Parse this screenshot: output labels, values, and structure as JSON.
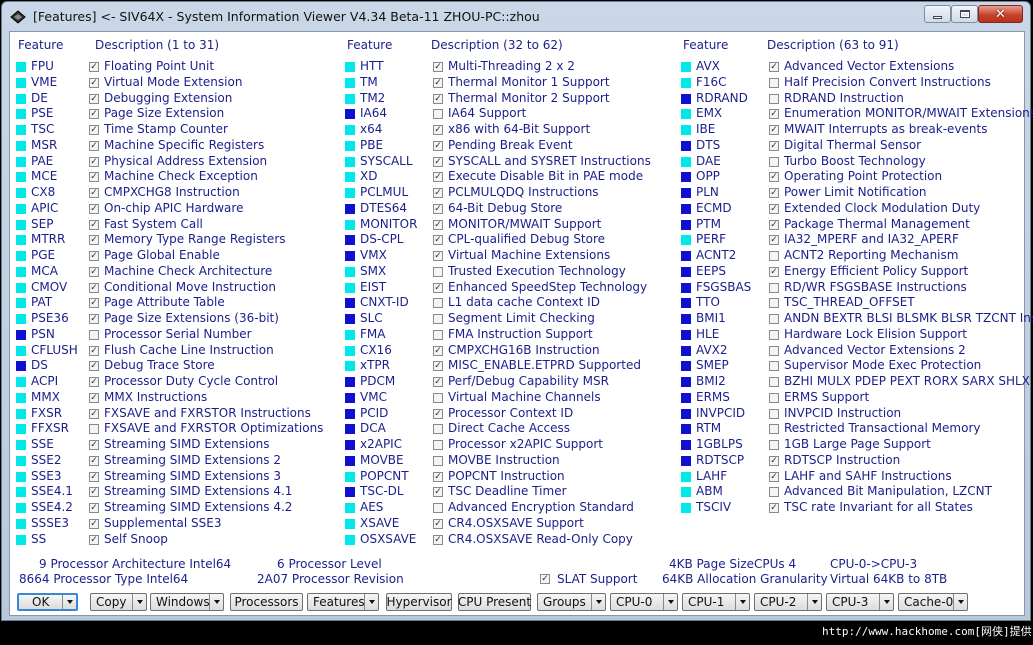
{
  "window": {
    "title": "[Features] <- SIV64X - System Information Viewer V4.34 Beta-11 ZHOU-PC::zhou",
    "icon": "app-icon"
  },
  "colors": {
    "cyan": "#00e8e8",
    "blue": "#1010d0",
    "text": "#1a1f8a"
  },
  "columns": [
    {
      "feature_header": "Feature",
      "desc_header": "Description (1 to 31)",
      "rows": [
        {
          "abbr": "FPU",
          "desc": "Floating Point Unit",
          "checked": true,
          "color": "cyan"
        },
        {
          "abbr": "VME",
          "desc": "Virtual Mode Extension",
          "checked": true,
          "color": "cyan"
        },
        {
          "abbr": "DE",
          "desc": "Debugging Extension",
          "checked": true,
          "color": "cyan"
        },
        {
          "abbr": "PSE",
          "desc": "Page Size Extension",
          "checked": true,
          "color": "cyan"
        },
        {
          "abbr": "TSC",
          "desc": "Time Stamp Counter",
          "checked": true,
          "color": "cyan"
        },
        {
          "abbr": "MSR",
          "desc": "Machine Specific Registers",
          "checked": true,
          "color": "cyan"
        },
        {
          "abbr": "PAE",
          "desc": "Physical Address Extension",
          "checked": true,
          "color": "cyan"
        },
        {
          "abbr": "MCE",
          "desc": "Machine Check Exception",
          "checked": true,
          "color": "cyan"
        },
        {
          "abbr": "CX8",
          "desc": "CMPXCHG8 Instruction",
          "checked": true,
          "color": "cyan"
        },
        {
          "abbr": "APIC",
          "desc": "On-chip APIC Hardware",
          "checked": true,
          "color": "cyan"
        },
        {
          "abbr": "SEP",
          "desc": "Fast System Call",
          "checked": true,
          "color": "cyan"
        },
        {
          "abbr": "MTRR",
          "desc": "Memory Type Range Registers",
          "checked": true,
          "color": "cyan"
        },
        {
          "abbr": "PGE",
          "desc": "Page Global Enable",
          "checked": true,
          "color": "cyan"
        },
        {
          "abbr": "MCA",
          "desc": "Machine Check Architecture",
          "checked": true,
          "color": "cyan"
        },
        {
          "abbr": "CMOV",
          "desc": "Conditional Move Instruction",
          "checked": true,
          "color": "cyan"
        },
        {
          "abbr": "PAT",
          "desc": "Page Attribute Table",
          "checked": true,
          "color": "cyan"
        },
        {
          "abbr": "PSE36",
          "desc": "Page Size Extensions (36-bit)",
          "checked": true,
          "color": "cyan"
        },
        {
          "abbr": "PSN",
          "desc": "Processor Serial Number",
          "checked": false,
          "color": "blue"
        },
        {
          "abbr": "CFLUSH",
          "desc": "Flush Cache Line Instruction",
          "checked": true,
          "color": "cyan"
        },
        {
          "abbr": "DS",
          "desc": "Debug Trace Store",
          "checked": true,
          "color": "blue"
        },
        {
          "abbr": "ACPI",
          "desc": "Processor Duty Cycle Control",
          "checked": true,
          "color": "cyan"
        },
        {
          "abbr": "MMX",
          "desc": "MMX Instructions",
          "checked": true,
          "color": "cyan"
        },
        {
          "abbr": "FXSR",
          "desc": "FXSAVE and FXRSTOR Instructions",
          "checked": true,
          "color": "cyan"
        },
        {
          "abbr": "FFXSR",
          "desc": "FXSAVE and FXRSTOR Optimizations",
          "checked": false,
          "color": "cyan"
        },
        {
          "abbr": "SSE",
          "desc": "Streaming SIMD Extensions",
          "checked": true,
          "color": "cyan"
        },
        {
          "abbr": "SSE2",
          "desc": "Streaming SIMD Extensions 2",
          "checked": true,
          "color": "cyan"
        },
        {
          "abbr": "SSE3",
          "desc": "Streaming SIMD Extensions 3",
          "checked": true,
          "color": "cyan"
        },
        {
          "abbr": "SSE4.1",
          "desc": "Streaming SIMD Extensions 4.1",
          "checked": true,
          "color": "cyan"
        },
        {
          "abbr": "SSE4.2",
          "desc": "Streaming SIMD Extensions 4.2",
          "checked": true,
          "color": "cyan"
        },
        {
          "abbr": "SSSE3",
          "desc": "Supplemental SSE3",
          "checked": true,
          "color": "cyan"
        },
        {
          "abbr": "SS",
          "desc": "Self Snoop",
          "checked": true,
          "color": "cyan"
        }
      ]
    },
    {
      "feature_header": "Feature",
      "desc_header": "Description (32 to 62)",
      "rows": [
        {
          "abbr": "HTT",
          "desc": "Multi-Threading 2 x 2",
          "checked": true,
          "color": "cyan"
        },
        {
          "abbr": "TM",
          "desc": "Thermal Monitor 1 Support",
          "checked": true,
          "color": "cyan"
        },
        {
          "abbr": "TM2",
          "desc": "Thermal Monitor 2 Support",
          "checked": true,
          "color": "cyan"
        },
        {
          "abbr": "IA64",
          "desc": "IA64 Support",
          "checked": false,
          "color": "blue"
        },
        {
          "abbr": "x64",
          "desc": "x86 with 64-Bit Support",
          "checked": true,
          "color": "cyan"
        },
        {
          "abbr": "PBE",
          "desc": "Pending Break Event",
          "checked": true,
          "color": "cyan"
        },
        {
          "abbr": "SYSCALL",
          "desc": "SYSCALL and SYSRET Instructions",
          "checked": true,
          "color": "cyan"
        },
        {
          "abbr": "XD",
          "desc": "Execute Disable Bit in PAE mode",
          "checked": true,
          "color": "cyan"
        },
        {
          "abbr": "PCLMUL",
          "desc": "PCLMULQDQ Instructions",
          "checked": true,
          "color": "cyan"
        },
        {
          "abbr": "DTES64",
          "desc": "64-Bit Debug Store",
          "checked": true,
          "color": "blue"
        },
        {
          "abbr": "MONITOR",
          "desc": "MONITOR/MWAIT Support",
          "checked": true,
          "color": "cyan"
        },
        {
          "abbr": "DS-CPL",
          "desc": "CPL-qualified Debug Store",
          "checked": true,
          "color": "blue"
        },
        {
          "abbr": "VMX",
          "desc": "Virtual Machine Extensions",
          "checked": true,
          "color": "blue"
        },
        {
          "abbr": "SMX",
          "desc": "Trusted Execution Technology",
          "checked": false,
          "color": "cyan"
        },
        {
          "abbr": "EIST",
          "desc": "Enhanced SpeedStep Technology",
          "checked": true,
          "color": "cyan"
        },
        {
          "abbr": "CNXT-ID",
          "desc": "L1 data cache Context ID",
          "checked": false,
          "color": "blue"
        },
        {
          "abbr": "SLC",
          "desc": "Segment Limit Checking",
          "checked": false,
          "color": "blue"
        },
        {
          "abbr": "FMA",
          "desc": "FMA Instruction Support",
          "checked": false,
          "color": "cyan"
        },
        {
          "abbr": "CX16",
          "desc": "CMPXCHG16B Instruction",
          "checked": true,
          "color": "cyan"
        },
        {
          "abbr": "xTPR",
          "desc": "MISC_ENABLE.ETPRD Supported",
          "checked": true,
          "color": "cyan"
        },
        {
          "abbr": "PDCM",
          "desc": "Perf/Debug Capability MSR",
          "checked": true,
          "color": "blue"
        },
        {
          "abbr": "VMC",
          "desc": "Virtual Machine Channels",
          "checked": false,
          "color": "blue"
        },
        {
          "abbr": "PCID",
          "desc": "Processor Context ID",
          "checked": true,
          "color": "blue"
        },
        {
          "abbr": "DCA",
          "desc": "Direct Cache Access",
          "checked": false,
          "color": "blue"
        },
        {
          "abbr": "x2APIC",
          "desc": "Processor x2APIC Support",
          "checked": false,
          "color": "blue"
        },
        {
          "abbr": "MOVBE",
          "desc": "MOVBE Instruction",
          "checked": false,
          "color": "blue"
        },
        {
          "abbr": "POPCNT",
          "desc": "POPCNT Instruction",
          "checked": true,
          "color": "cyan"
        },
        {
          "abbr": "TSC-DL",
          "desc": "TSC Deadline Timer",
          "checked": true,
          "color": "blue"
        },
        {
          "abbr": "AES",
          "desc": "Advanced Encryption Standard",
          "checked": false,
          "color": "cyan"
        },
        {
          "abbr": "XSAVE",
          "desc": "CR4.OSXSAVE Support",
          "checked": true,
          "color": "cyan"
        },
        {
          "abbr": "OSXSAVE",
          "desc": "CR4.OSXSAVE Read-Only Copy",
          "checked": true,
          "color": "cyan"
        }
      ]
    },
    {
      "feature_header": "Feature",
      "desc_header": "Description (63 to 91)",
      "rows": [
        {
          "abbr": "AVX",
          "desc": "Advanced Vector Extensions",
          "checked": true,
          "color": "cyan"
        },
        {
          "abbr": "F16C",
          "desc": "Half Precision Convert Instructions",
          "checked": false,
          "color": "cyan"
        },
        {
          "abbr": "RDRAND",
          "desc": "RDRAND Instruction",
          "checked": false,
          "color": "blue"
        },
        {
          "abbr": "EMX",
          "desc": "Enumeration MONITOR/MWAIT Extensions",
          "checked": true,
          "color": "cyan"
        },
        {
          "abbr": "IBE",
          "desc": "MWAIT Interrupts as break-events",
          "checked": true,
          "color": "cyan"
        },
        {
          "abbr": "DTS",
          "desc": "Digital Thermal Sensor",
          "checked": true,
          "color": "blue"
        },
        {
          "abbr": "DAE",
          "desc": "Turbo Boost Technology",
          "checked": false,
          "color": "cyan"
        },
        {
          "abbr": "OPP",
          "desc": "Operating Point Protection",
          "checked": true,
          "color": "blue"
        },
        {
          "abbr": "PLN",
          "desc": "Power Limit Notification",
          "checked": true,
          "color": "blue"
        },
        {
          "abbr": "ECMD",
          "desc": "Extended Clock Modulation Duty",
          "checked": true,
          "color": "blue"
        },
        {
          "abbr": "PTM",
          "desc": "Package Thermal Management",
          "checked": true,
          "color": "blue"
        },
        {
          "abbr": "PERF",
          "desc": "IA32_MPERF and IA32_APERF",
          "checked": true,
          "color": "cyan"
        },
        {
          "abbr": "ACNT2",
          "desc": "ACNT2 Reporting Mechanism",
          "checked": false,
          "color": "blue"
        },
        {
          "abbr": "EEPS",
          "desc": "Energy Efficient Policy Support",
          "checked": true,
          "color": "blue"
        },
        {
          "abbr": "FSGSBAS",
          "desc": "RD/WR FSGSBASE Instructions",
          "checked": false,
          "color": "blue"
        },
        {
          "abbr": "TTO",
          "desc": "TSC_THREAD_OFFSET",
          "checked": false,
          "color": "blue"
        },
        {
          "abbr": "BMI1",
          "desc": "ANDN BEXTR BLSI BLSMK BLSR TZCNT Ins",
          "checked": false,
          "color": "blue"
        },
        {
          "abbr": "HLE",
          "desc": "Hardware Lock Elision Support",
          "checked": false,
          "color": "blue"
        },
        {
          "abbr": "AVX2",
          "desc": "Advanced Vector Extensions 2",
          "checked": false,
          "color": "blue"
        },
        {
          "abbr": "SMEP",
          "desc": "Supervisor Mode Exec Protection",
          "checked": false,
          "color": "blue"
        },
        {
          "abbr": "BMI2",
          "desc": "BZHI MULX PDEP PEXT RORX SARX SHLX S",
          "checked": false,
          "color": "blue"
        },
        {
          "abbr": "ERMS",
          "desc": "ERMS Support",
          "checked": false,
          "color": "blue"
        },
        {
          "abbr": "INVPCID",
          "desc": "INVPCID Instruction",
          "checked": false,
          "color": "blue"
        },
        {
          "abbr": "RTM",
          "desc": "Restricted Transactional Memory",
          "checked": false,
          "color": "blue"
        },
        {
          "abbr": "1GBLPS",
          "desc": "1GB Large Page Support",
          "checked": false,
          "color": "blue"
        },
        {
          "abbr": "RDTSCP",
          "desc": "RDTSCP Instruction",
          "checked": true,
          "color": "blue"
        },
        {
          "abbr": "LAHF",
          "desc": "LAHF and SAHF Instructions",
          "checked": true,
          "color": "cyan"
        },
        {
          "abbr": "ABM",
          "desc": "Advanced Bit Manipulation, LZCNT",
          "checked": false,
          "color": "cyan"
        },
        {
          "abbr": "TSCIV",
          "desc": "TSC rate Invariant for all States",
          "checked": true,
          "color": "cyan"
        }
      ]
    }
  ],
  "info": {
    "arch": "9 Processor Architecture Intel64",
    "type": "8664 Processor Type Intel64",
    "level": "6 Processor Level",
    "revision": "2A07 Processor Revision",
    "slat": "SLAT Support",
    "slat_checked": true,
    "page_size": "4KB Page Size",
    "alloc": "64KB Allocation Granularity",
    "cpus": "CPUs 4",
    "cpu_range": "CPU-0->CPU-3",
    "virtual": "Virtual 64KB to 8TB"
  },
  "toolbar": [
    {
      "label": "OK",
      "dropdown": true,
      "default": true
    },
    {
      "label": "Copy",
      "dropdown": true
    },
    {
      "label": "Windows",
      "dropdown": true
    },
    {
      "label": "Processors",
      "dropdown": false
    },
    {
      "label": "Features",
      "dropdown": true
    },
    {
      "label": "Hypervisor",
      "dropdown": false
    },
    {
      "label": "CPU Present",
      "dropdown": false
    },
    {
      "label": "Groups",
      "dropdown": true
    },
    {
      "label": "CPU-0",
      "dropdown": true
    },
    {
      "label": "CPU-1",
      "dropdown": true
    },
    {
      "label": "CPU-2",
      "dropdown": true
    },
    {
      "label": "CPU-3",
      "dropdown": true
    },
    {
      "label": "Cache-0",
      "dropdown": true
    }
  ],
  "watermark": "http://www.hackhome.com[网侠]提供"
}
